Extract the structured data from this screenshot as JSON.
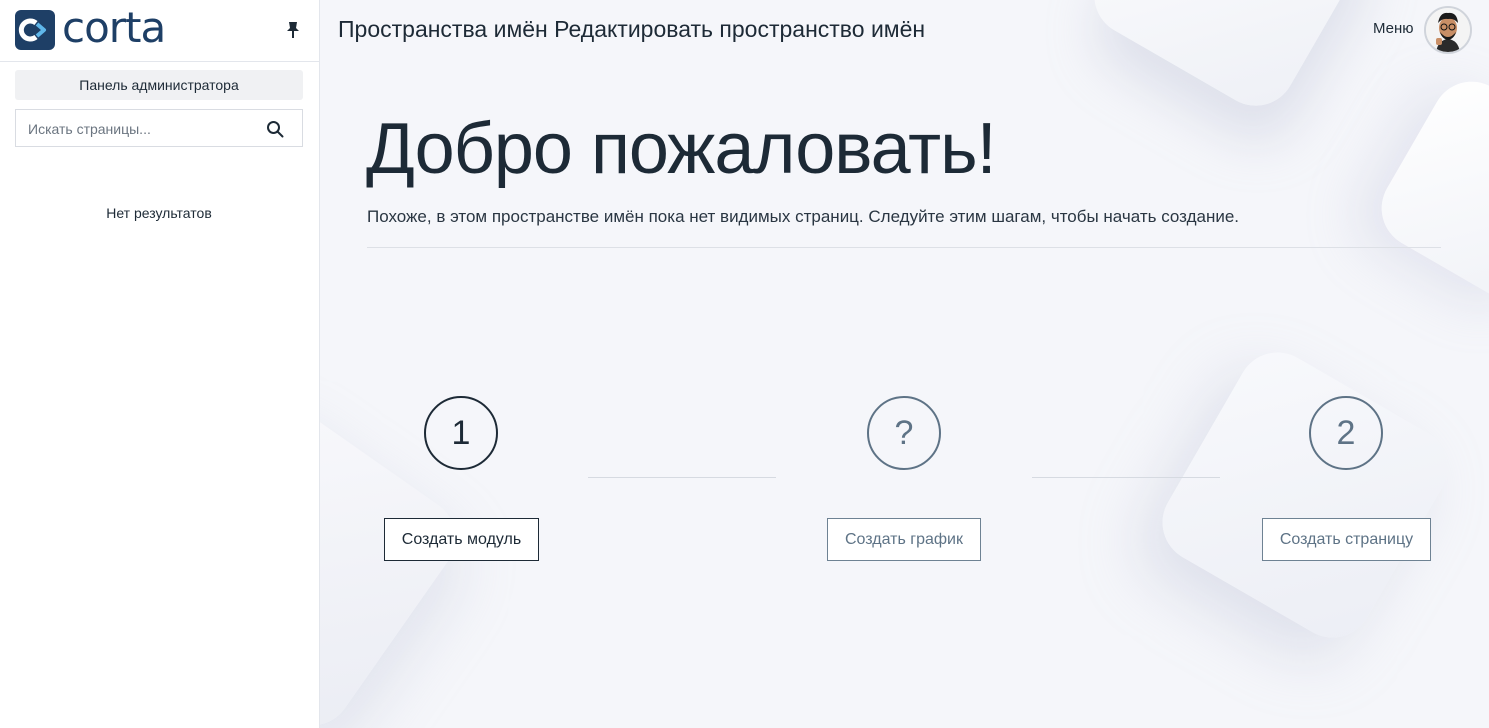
{
  "sidebar": {
    "logo_text": "corta",
    "admin_panel_label": "Панель администратора",
    "search_placeholder": "Искать страницы...",
    "no_results": "Нет результатов"
  },
  "header": {
    "title": "Пространства имён Редактировать пространство имён",
    "menu_label": "Меню"
  },
  "main": {
    "welcome_title": "Добро пожаловать!",
    "subtitle": "Похоже, в этом пространстве имён пока нет видимых страниц. Следуйте этим шагам, чтобы начать создание.",
    "steps": [
      {
        "number": "1",
        "button_label": "Создать модуль",
        "active": true
      },
      {
        "number": "?",
        "button_label": "Создать график",
        "active": false
      },
      {
        "number": "2",
        "button_label": "Создать страницу",
        "active": false
      }
    ]
  },
  "colors": {
    "brand": "#1e3f66",
    "text": "#1d2a36",
    "muted": "#5e7386",
    "background": "#f5f6fa"
  },
  "icons": {
    "pin": "pin-icon",
    "search": "search-icon",
    "logo": "corta-logo-icon"
  }
}
